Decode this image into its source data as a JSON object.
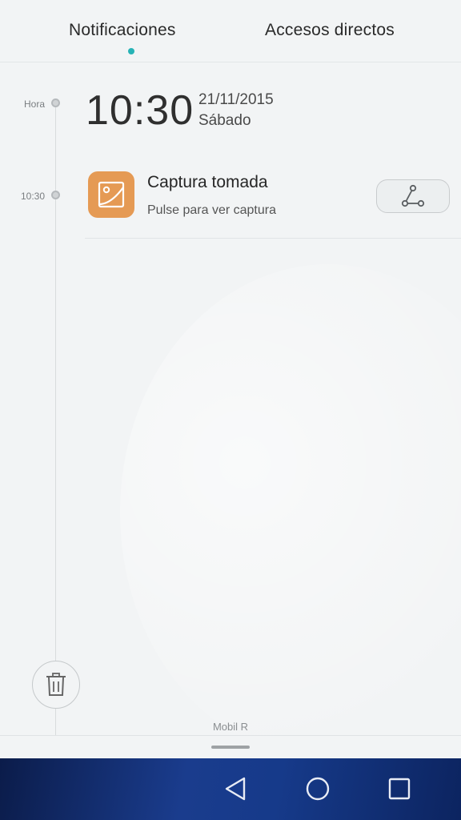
{
  "tabs": {
    "notifications": "Notificaciones",
    "shortcuts": "Accesos directos",
    "active": "notifications",
    "accent": "#27b3b6"
  },
  "timeline": {
    "label_now": "Hora",
    "label_event": "10:30"
  },
  "clock": {
    "time": "10:30",
    "date": "21/11/2015",
    "day": "Sábado"
  },
  "notification": {
    "app_icon": "image-icon",
    "icon_color": "#e59a54",
    "title": "Captura tomada",
    "subtitle": "Pulse para ver captura",
    "action_icon": "share-icon"
  },
  "footer": {
    "carrier": "Mobil R",
    "clear_icon": "trash-icon"
  },
  "navbar": {
    "back_icon": "back-icon",
    "home_icon": "home-icon",
    "recent_icon": "recent-apps-icon"
  }
}
